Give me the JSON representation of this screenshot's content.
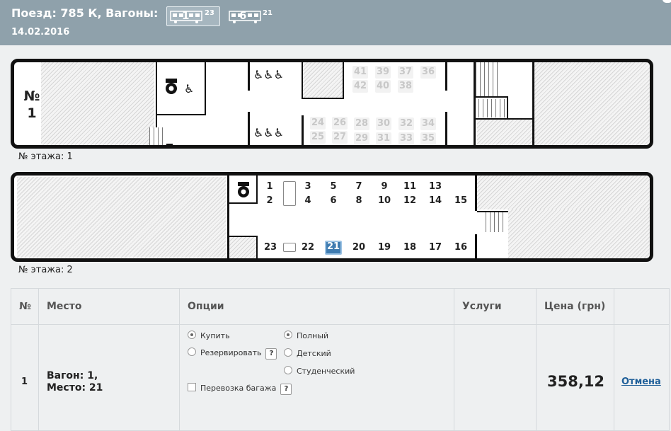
{
  "header": {
    "title": "Поезд: 785 К, Вагоны:",
    "date": "14.02.2016",
    "wagons": [
      {
        "number": "1",
        "free_seats": "23",
        "selected": true
      },
      {
        "number": "6",
        "free_seats": "21",
        "selected": false
      }
    ]
  },
  "car1": {
    "car_label_line1": "№",
    "car_label_line2": "1",
    "floor_label": "№ этажа: 1",
    "seats_upper_row1": [
      "41",
      "39",
      "37",
      "36"
    ],
    "seats_upper_row2": [
      "42",
      "40",
      "38"
    ],
    "seats_lower_row1": [
      "24",
      "26",
      "28",
      "30",
      "32",
      "34"
    ],
    "seats_lower_row2": [
      "25",
      "27",
      "29",
      "31",
      "33",
      "35"
    ]
  },
  "car2": {
    "floor_label": "№ этажа: 2",
    "seats_top_row1": [
      "1",
      "3",
      "5",
      "7",
      "9",
      "11",
      "13"
    ],
    "seats_top_row2": [
      "2",
      "4",
      "6",
      "8",
      "10",
      "12",
      "14",
      "15"
    ],
    "seats_bottom": [
      "23",
      "22",
      "21",
      "20",
      "19",
      "18",
      "17",
      "16"
    ],
    "selected_seat": "21"
  },
  "table": {
    "headers": {
      "num": "№",
      "place": "Место",
      "options": "Опции",
      "services": "Услуги",
      "price": "Цена (грн)"
    },
    "row": {
      "num": "1",
      "place_line1": "Вагон: 1,",
      "place_line2": "Место: 21",
      "opt_buy": "Купить",
      "opt_reserve": "Резервировать",
      "opt_baggage": "Перевозка багажа",
      "ticket_full": "Полный",
      "ticket_child": "Детский",
      "ticket_student": "Студенческий",
      "help": "?",
      "price": "358,12",
      "cancel": "Отмена"
    }
  },
  "colors": {
    "header_bg": "#8fa1ab",
    "selected_seat": "#3e7bb0",
    "link": "#1f5f99"
  }
}
